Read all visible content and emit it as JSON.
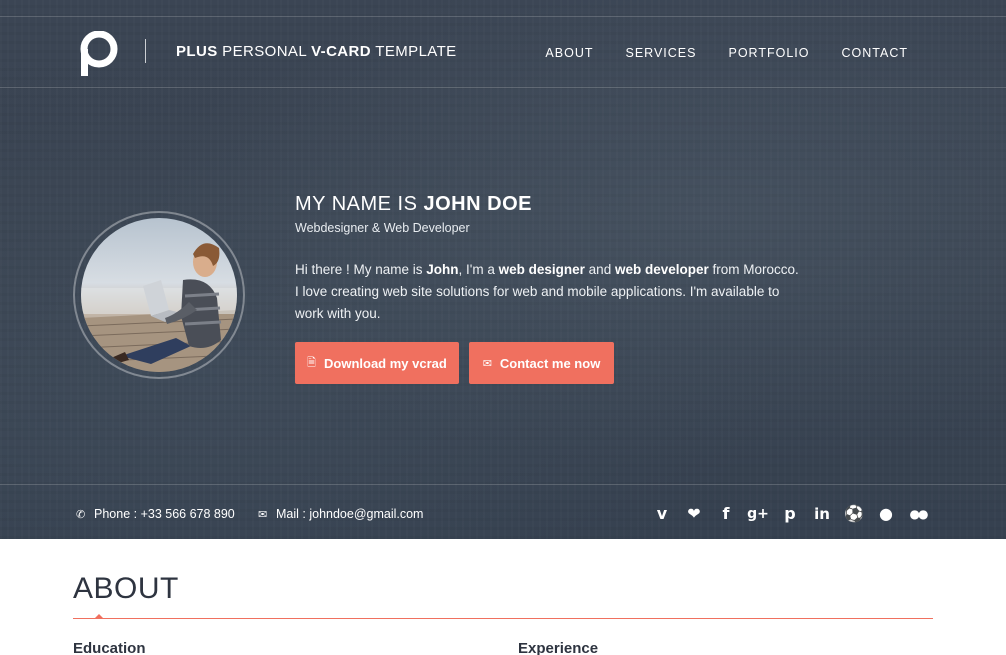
{
  "header": {
    "brand_bold_1": "PLUS",
    "brand_light_1": " PERSONAL ",
    "brand_bold_2": "V-CARD",
    "brand_light_2": " TEMPLATE",
    "nav": [
      "ABOUT",
      "SERVICES",
      "PORTFOLIO",
      "CONTACT"
    ]
  },
  "intro": {
    "headline_light": "MY NAME IS ",
    "headline_bold": "JOHN DOE",
    "subtitle": "Webdesigner & Web Developer",
    "bio": {
      "p1": "Hi there ! My name is ",
      "name": "John",
      "p2": ", I'm a ",
      "role1": "web designer",
      "p3": " and ",
      "role2": "web developer",
      "p4": " from Morocco. I love creating web site solutions for web and mobile applications. I'm available to work with you."
    },
    "buttons": {
      "download": "Download my vcrad",
      "contact": "Contact me now"
    }
  },
  "contact": {
    "phone": "Phone : +33 566 678 890",
    "mail": "Mail : johndoe@gmail.com",
    "socials": [
      "vimeo-icon",
      "twitter-icon",
      "facebook-icon",
      "google-plus-icon",
      "pinterest-icon",
      "linkedin-icon",
      "dribbble-icon",
      "github-icon",
      "flickr-icon"
    ]
  },
  "about": {
    "title": "ABOUT",
    "education": "Education",
    "experience": "Experience"
  },
  "colors": {
    "accent": "#f0705f",
    "hero_bg": "#3a4452",
    "heading": "#2e3440"
  }
}
